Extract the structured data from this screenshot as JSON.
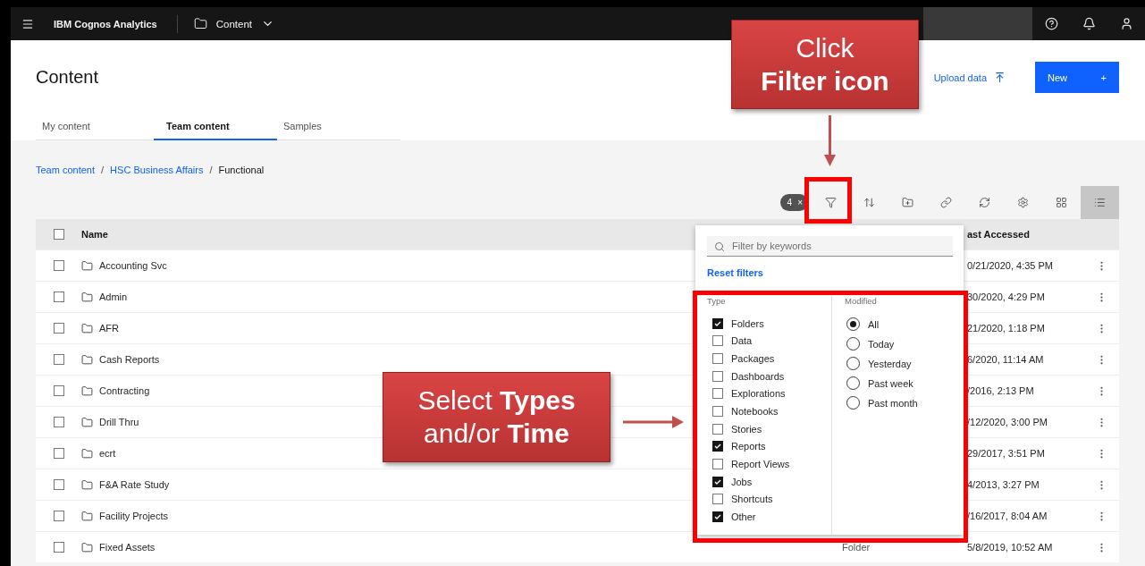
{
  "topbar": {
    "app_name": "IBM Cognos Analytics",
    "location": "Content"
  },
  "page": {
    "title": "Content",
    "upload_label": "Upload data",
    "new_label": "New",
    "new_icon": "+"
  },
  "tabs": [
    {
      "label": "My content",
      "selected": false
    },
    {
      "label": "Team content",
      "selected": true
    },
    {
      "label": "Samples",
      "selected": false
    }
  ],
  "breadcrumb": {
    "separator": "/",
    "items": [
      {
        "label": "Team content",
        "kind": "link"
      },
      {
        "label": "HSC Business Affairs",
        "kind": "link"
      },
      {
        "label": "Functional",
        "kind": "current"
      }
    ]
  },
  "toolbar": {
    "filter_count": "4",
    "clear_icon": "×",
    "buttons": [
      {
        "kind": "filter",
        "selected": false
      },
      {
        "kind": "sort",
        "selected": false
      },
      {
        "kind": "folder",
        "selected": false
      },
      {
        "kind": "link",
        "selected": false
      },
      {
        "kind": "refresh",
        "selected": false
      },
      {
        "kind": "settings",
        "selected": false
      },
      {
        "kind": "grid",
        "selected": false
      },
      {
        "kind": "list",
        "selected": true
      }
    ]
  },
  "table": {
    "all_checked": false,
    "columns": {
      "name": "Name",
      "last_accessed": "ast Accessed"
    },
    "rows": [
      {
        "name": "Accounting Svc",
        "checked": false,
        "last_accessed": "0/21/2020, 4:35 PM"
      },
      {
        "name": "Admin",
        "checked": false,
        "last_accessed": "30/2020, 4:29 PM"
      },
      {
        "name": "AFR",
        "checked": false,
        "last_accessed": "21/2020, 1:18 PM"
      },
      {
        "name": "Cash Reports",
        "checked": false,
        "last_accessed": "6/2020, 11:14 AM"
      },
      {
        "name": "Contracting",
        "checked": false,
        "last_accessed": "/2016, 2:13 PM"
      },
      {
        "name": "Drill Thru",
        "checked": false,
        "last_accessed": "/12/2020, 3:00 PM"
      },
      {
        "name": "ecrt",
        "checked": false,
        "last_accessed": "29/2017, 3:51 PM"
      },
      {
        "name": "F&A Rate Study",
        "checked": false,
        "last_accessed": "4/2013, 3:27 PM"
      },
      {
        "name": "Facility Projects",
        "checked": false,
        "last_accessed": "/16/2017, 8:04 AM"
      },
      {
        "name": "Fixed Assets",
        "checked": false,
        "type": "Folder",
        "last_accessed": "5/8/2019, 10:52 AM"
      }
    ]
  },
  "filter_panel": {
    "placeholder": "Filter by keywords",
    "reset": "Reset filters",
    "type_heading": "Type",
    "modified_heading": "Modified",
    "types": [
      {
        "label": "Folders",
        "checked": true
      },
      {
        "label": "Data",
        "checked": false
      },
      {
        "label": "Packages",
        "checked": false
      },
      {
        "label": "Dashboards",
        "checked": false
      },
      {
        "label": "Explorations",
        "checked": false
      },
      {
        "label": "Notebooks",
        "checked": false
      },
      {
        "label": "Stories",
        "checked": false
      },
      {
        "label": "Reports",
        "checked": true
      },
      {
        "label": "Report Views",
        "checked": false
      },
      {
        "label": "Jobs",
        "checked": true
      },
      {
        "label": "Shortcuts",
        "checked": false
      },
      {
        "label": "Other",
        "checked": true
      }
    ],
    "modified": [
      {
        "label": "All",
        "selected": true
      },
      {
        "label": "Today",
        "selected": false
      },
      {
        "label": "Yesterday",
        "selected": false
      },
      {
        "label": "Past week",
        "selected": false
      },
      {
        "label": "Past month",
        "selected": false
      }
    ]
  },
  "annotations": [
    {
      "kind": "click",
      "lines": [
        "Click",
        "**Filter icon**"
      ]
    },
    {
      "kind": "select",
      "lines": [
        "Select **Types**",
        "and/or **Time**"
      ]
    }
  ]
}
